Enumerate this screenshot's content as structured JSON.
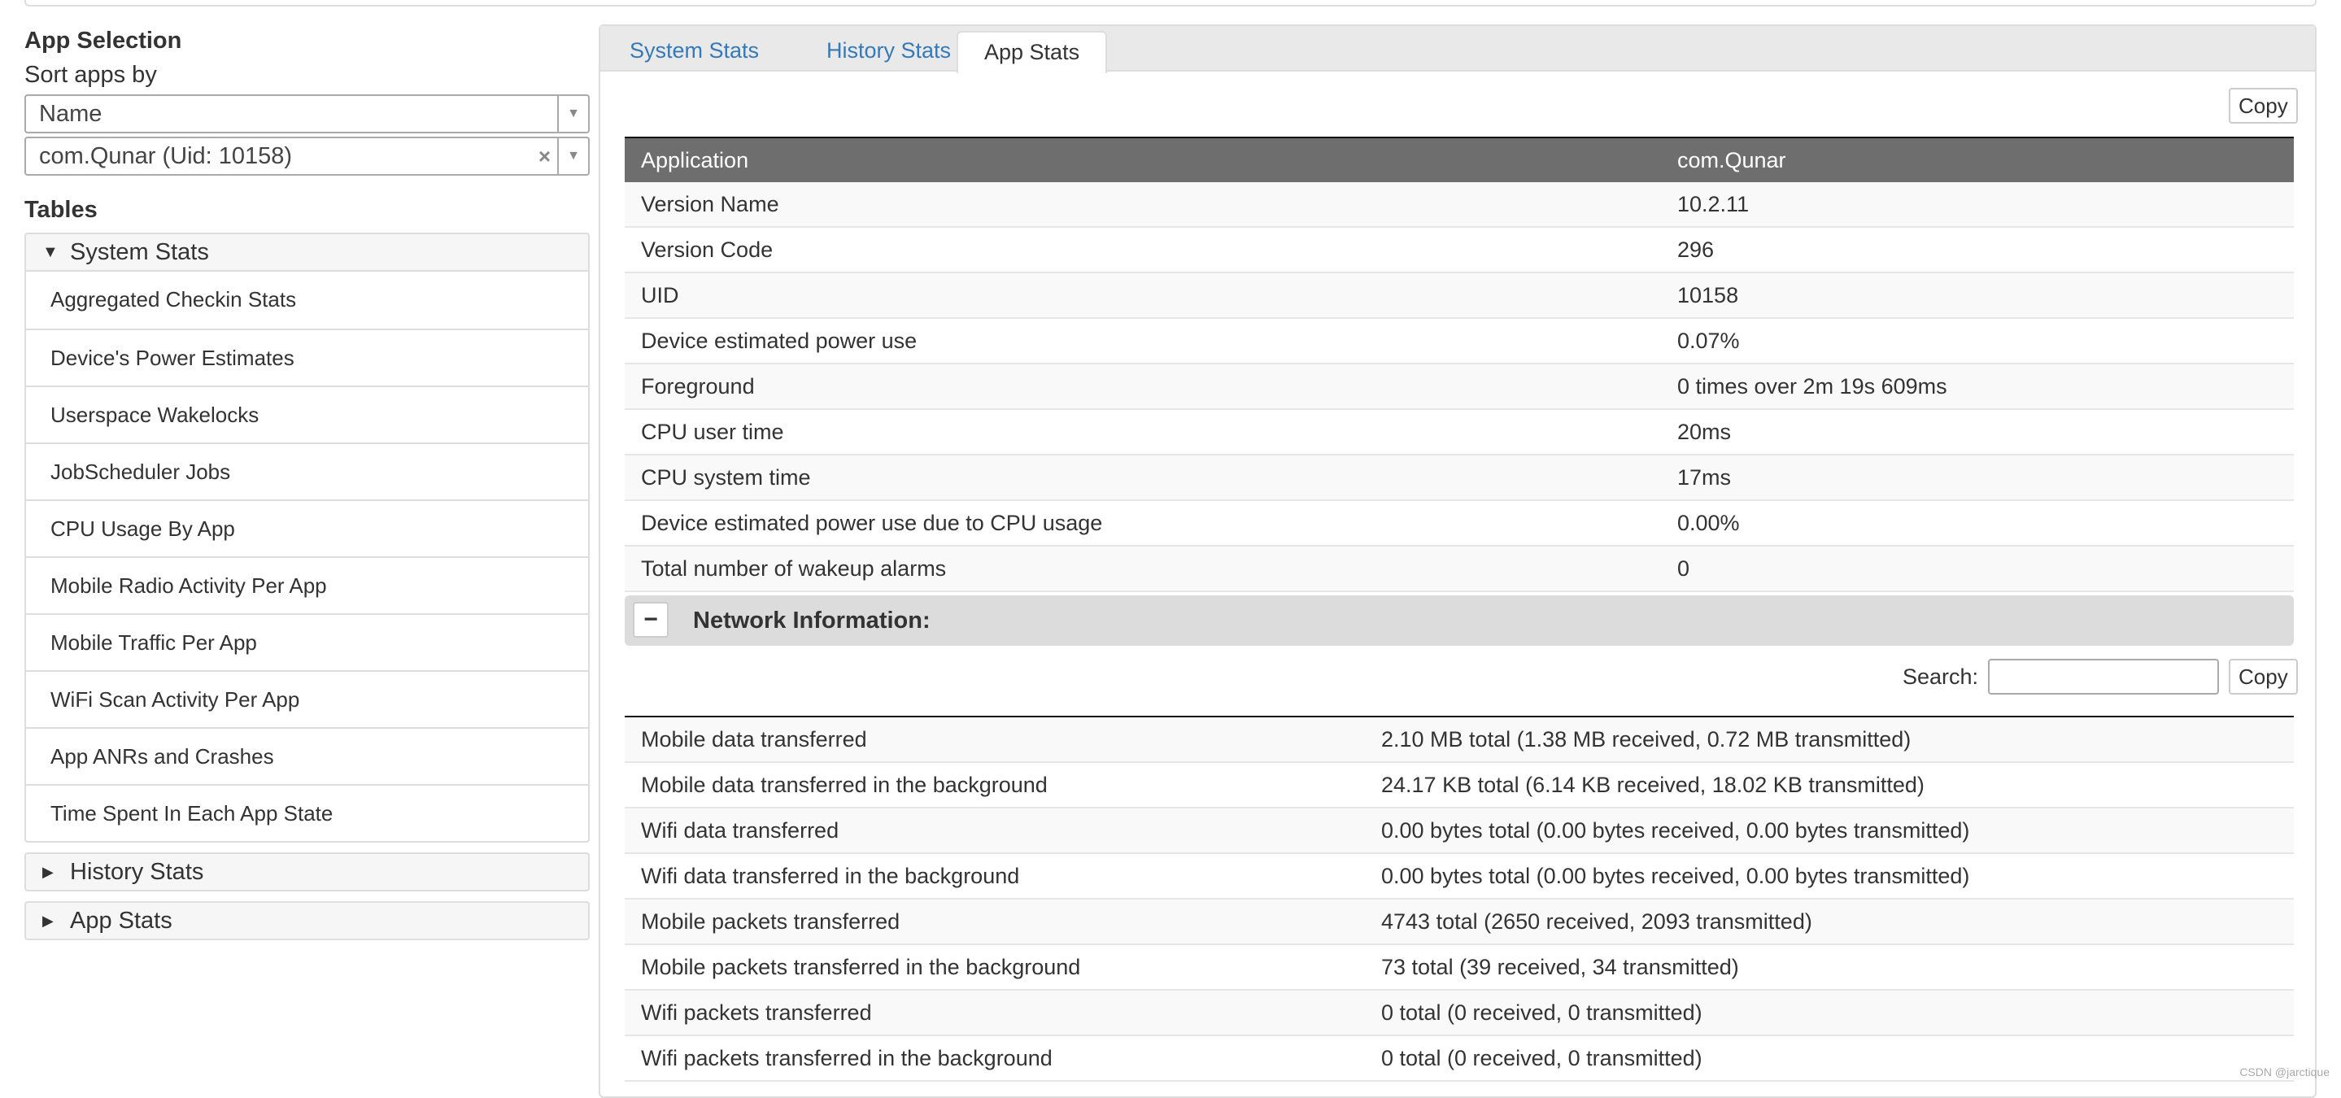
{
  "sidebar": {
    "app_selection_title": "App Selection",
    "sort_label": "Sort apps by",
    "sort_value": "Name",
    "app_value": "com.Qunar (Uid: 10158)",
    "tables_title": "Tables",
    "system_stats_header": "System Stats",
    "system_stats_items": [
      "Aggregated Checkin Stats",
      "Device's Power Estimates",
      "Userspace Wakelocks",
      "JobScheduler Jobs",
      "CPU Usage By App",
      "Mobile Radio Activity Per App",
      "Mobile Traffic Per App",
      "WiFi Scan Activity Per App",
      "App ANRs and Crashes",
      "Time Spent In Each App State"
    ],
    "history_stats_header": "History Stats",
    "app_stats_header": "App Stats"
  },
  "tabs": [
    "System Stats",
    "History Stats",
    "App Stats"
  ],
  "copy_label": "Copy",
  "app_table": {
    "header": [
      "Application",
      "com.Qunar"
    ],
    "rows": [
      [
        "Version Name",
        "10.2.11"
      ],
      [
        "Version Code",
        "296"
      ],
      [
        "UID",
        "10158"
      ],
      [
        "Device estimated power use",
        "0.07%"
      ],
      [
        "Foreground",
        "0 times over 2m 19s 609ms"
      ],
      [
        "CPU user time",
        "20ms"
      ],
      [
        "CPU system time",
        "17ms"
      ],
      [
        "Device estimated power use due to CPU usage",
        "0.00%"
      ],
      [
        "Total number of wakeup alarms",
        "0"
      ]
    ]
  },
  "network": {
    "toggle": "−",
    "title": "Network Information:",
    "search_label": "Search:",
    "search_value": "",
    "rows": [
      [
        "Mobile data transferred",
        "2.10 MB total (1.38 MB received, 0.72 MB transmitted)"
      ],
      [
        "Mobile data transferred in the background",
        "24.17 KB total (6.14 KB received, 18.02 KB transmitted)"
      ],
      [
        "Wifi data transferred",
        "0.00 bytes total (0.00 bytes received, 0.00 bytes transmitted)"
      ],
      [
        "Wifi data transferred in the background",
        "0.00 bytes total (0.00 bytes received, 0.00 bytes transmitted)"
      ],
      [
        "Mobile packets transferred",
        "4743 total (2650 received, 2093 transmitted)"
      ],
      [
        "Mobile packets transferred in the background",
        "73 total (39 received, 34 transmitted)"
      ],
      [
        "Wifi packets transferred",
        "0 total (0 received, 0 transmitted)"
      ],
      [
        "Wifi packets transferred in the background",
        "0 total (0 received, 0 transmitted)"
      ]
    ]
  },
  "watermark": "CSDN @jarctique"
}
